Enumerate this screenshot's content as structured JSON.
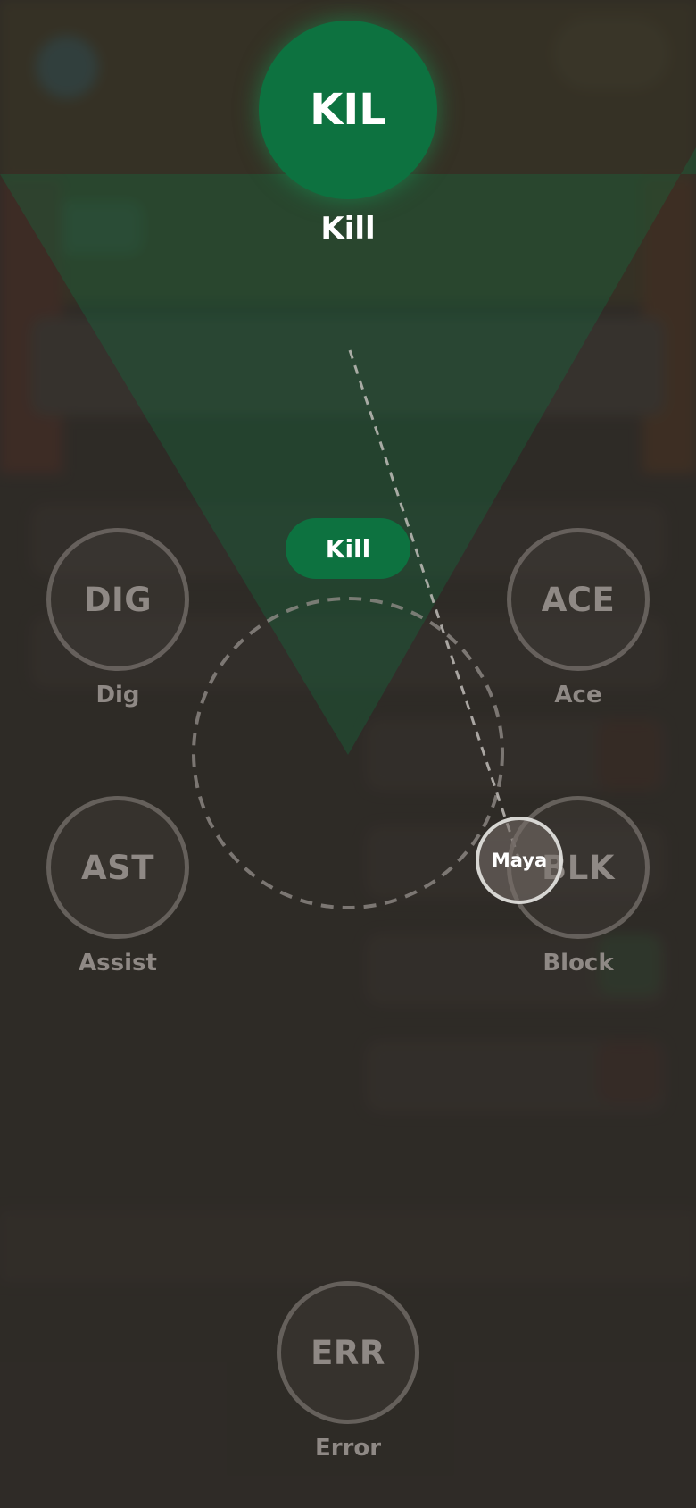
{
  "selected_action": {
    "code": "KIL",
    "label": "Kill"
  },
  "selection_pill": "Kill",
  "player_chip": "Maya",
  "actions": {
    "dig": {
      "code": "DIG",
      "label": "Dig"
    },
    "ace": {
      "code": "ACE",
      "label": "Ace"
    },
    "assist": {
      "code": "AST",
      "label": "Assist"
    },
    "block": {
      "code": "BLK",
      "label": "Block"
    },
    "error": {
      "code": "ERR",
      "label": "Error"
    }
  },
  "colors": {
    "accent_green": "#0d7240",
    "overlay": "#2e2a27",
    "inactive_text": "#8f8985"
  }
}
